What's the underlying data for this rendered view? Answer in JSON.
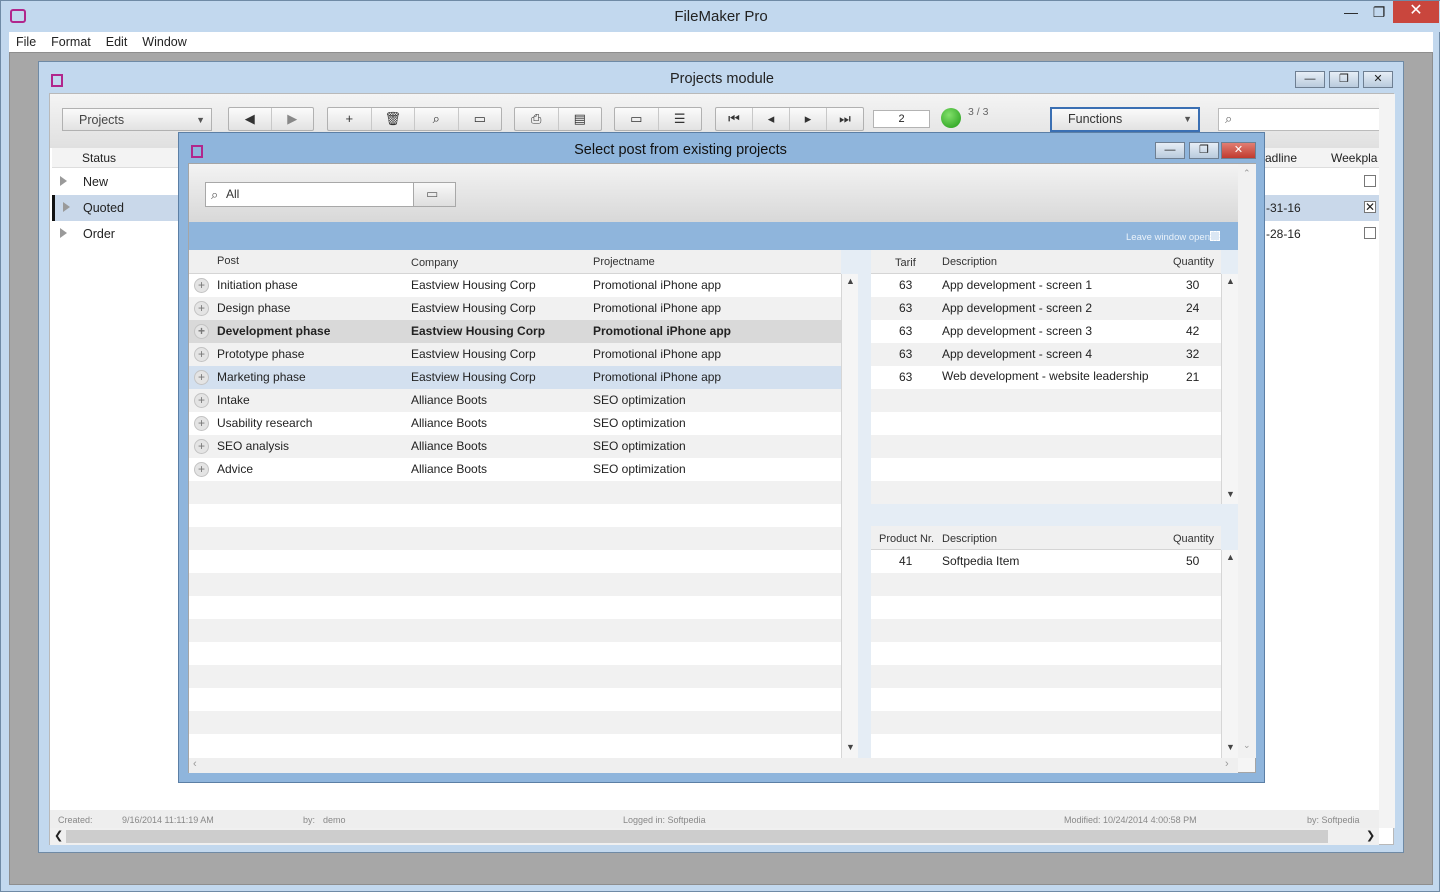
{
  "app": {
    "title": "FileMaker Pro",
    "menu": [
      "File",
      "Format",
      "Edit",
      "Window"
    ],
    "win_minimize": "—",
    "win_restore": "❐",
    "win_close": "✕"
  },
  "module": {
    "title": "Projects module",
    "layout_dropdown": "Projects",
    "functions_dropdown": "Functions",
    "record_number": "2",
    "record_count": "3 / 3",
    "toolbar": {
      "nav_prev": "◀",
      "nav_next": "▶",
      "add": "+",
      "delete": "🗑",
      "find": "⌕",
      "first": "⏮",
      "prev_record": "◂",
      "next_record": "▸",
      "last": "⏭"
    },
    "list_headers": {
      "status": "Status",
      "deadline": "adline",
      "weekplan": "Weekpla"
    },
    "rows": [
      {
        "status": "New",
        "deadline": "",
        "weekplan_checked": false,
        "selected": false
      },
      {
        "status": "Quoted",
        "deadline": "-31-16",
        "weekplan_checked": true,
        "selected": true
      },
      {
        "status": "Order",
        "deadline": "-28-16",
        "weekplan_checked": false,
        "selected": false
      }
    ],
    "footer": {
      "created_label": "Created:",
      "created_value": "9/16/2014 11:11:19 AM",
      "by_label": "by:",
      "by_value": "demo",
      "logged_in": "Logged in: Softpedia",
      "modified": "Modified: 10/24/2014 4:00:58 PM",
      "modified_by": "by: Softpedia"
    }
  },
  "dialog": {
    "title": "Select post from existing projects",
    "search_value": "All",
    "leave_window_open_label": "Leave window open",
    "posts_headers": {
      "post": "Post",
      "company": "Company",
      "projectname": "Projectname"
    },
    "posts": [
      {
        "post": "Initiation phase",
        "company": "Eastview Housing Corp",
        "projectname": "Promotional iPhone app",
        "state": "normal"
      },
      {
        "post": "Design phase",
        "company": "Eastview Housing Corp",
        "projectname": "Promotional iPhone app",
        "state": "normal"
      },
      {
        "post": "Development phase",
        "company": "Eastview Housing Corp",
        "projectname": "Promotional iPhone app",
        "state": "selected"
      },
      {
        "post": "Prototype phase",
        "company": "Eastview Housing Corp",
        "projectname": "Promotional iPhone app",
        "state": "normal"
      },
      {
        "post": "Marketing phase",
        "company": "Eastview Housing Corp",
        "projectname": "Promotional iPhone app",
        "state": "hover"
      },
      {
        "post": "Intake",
        "company": "Alliance Boots",
        "projectname": "SEO optimization",
        "state": "normal"
      },
      {
        "post": "Usability research",
        "company": "Alliance Boots",
        "projectname": "SEO optimization",
        "state": "normal"
      },
      {
        "post": "SEO analysis",
        "company": "Alliance Boots",
        "projectname": "SEO optimization",
        "state": "normal"
      },
      {
        "post": "Advice",
        "company": "Alliance Boots",
        "projectname": "SEO optimization",
        "state": "normal"
      }
    ],
    "tasks_headers": {
      "tarif": "Tarif",
      "description": "Description",
      "quantity": "Quantity"
    },
    "tasks": [
      {
        "tarif": "63",
        "description": "App development - screen 1",
        "quantity": "30"
      },
      {
        "tarif": "63",
        "description": "App development - screen 2",
        "quantity": "24"
      },
      {
        "tarif": "63",
        "description": "App development - screen 3",
        "quantity": "42"
      },
      {
        "tarif": "63",
        "description": "App development - screen 4",
        "quantity": "32"
      },
      {
        "tarif": "63",
        "description": "Web development - website leadership",
        "quantity": "21"
      }
    ],
    "products_headers": {
      "product_nr": "Product Nr.",
      "description": "Description",
      "quantity": "Quantity"
    },
    "products": [
      {
        "product_nr": "41",
        "description": "Softpedia Item",
        "quantity": "50"
      }
    ]
  },
  "colors": {
    "title_bar": "#c2d8ee",
    "dialog_band": "#8fb5dc",
    "close_button": "#c9463d",
    "status_light": "#2fb020",
    "app_icon": "#b1268c"
  },
  "icons": [
    "app-icon",
    "module-icon",
    "search-icon",
    "filter-icon",
    "print-icon",
    "status-light-icon",
    "checkbox-icon",
    "row-arrow-icon",
    "plus-icon"
  ]
}
